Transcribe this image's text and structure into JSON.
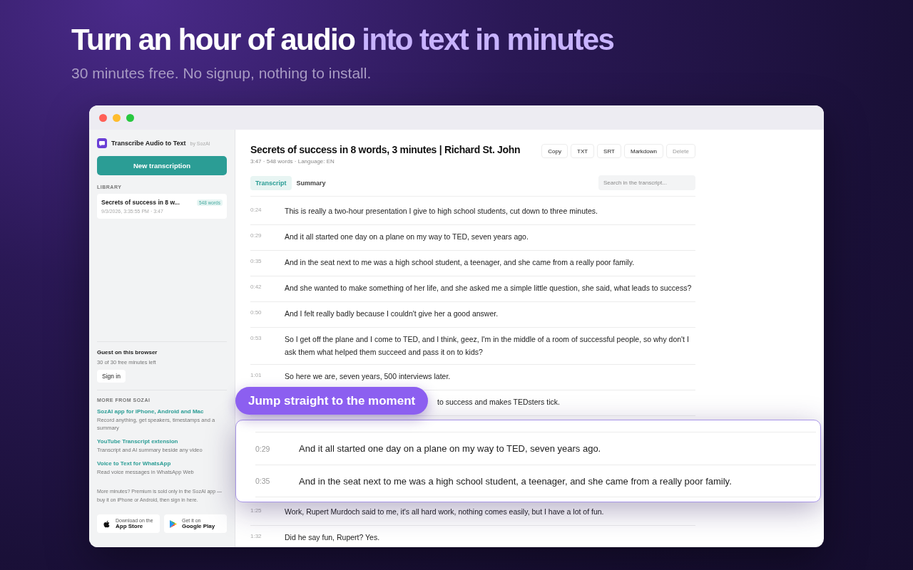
{
  "hero": {
    "title_plain": "Turn an hour of audio",
    "title_highlight": "into text in minutes",
    "subtitle": "30 minutes free. No signup, nothing to install."
  },
  "sidebar": {
    "app_title": "Transcribe Audio to Text",
    "app_by": "by SozAI",
    "new_button": "New transcription",
    "library_label": "LIBRARY",
    "library": [
      {
        "title": "Secrets of success in 8 w...",
        "badge": "548 words",
        "meta": "9/3/2026, 3:35:55 PM · 3:47",
        "selected": true
      }
    ],
    "guest_title": "Guest on this browser",
    "guest_minutes": "30 of 30 free minutes left",
    "sign_in": "Sign in",
    "more_label": "MORE FROM SOZAI",
    "links": [
      {
        "title": "SozAI app for iPhone, Android and Mac",
        "desc": "Record anything, get speakers, timestamps and a summary"
      },
      {
        "title": "YouTube Transcript extension",
        "desc": "Transcript and AI summary beside any video"
      },
      {
        "title": "Voice to Text for WhatsApp",
        "desc": "Read voice messages in WhatsApp Web"
      }
    ],
    "premium_note": "More minutes? Premium is sold only in the SozAI app — buy it on iPhone or Android, then sign in here.",
    "stores": [
      {
        "kind": "apple",
        "small": "Download on the",
        "big": "App Store"
      },
      {
        "kind": "google",
        "small": "Get it on",
        "big": "Google Play"
      }
    ]
  },
  "main": {
    "title": "Secrets of success in 8 words, 3 minutes | Richard St. John",
    "meta": "3:47 · 548 words · Language: EN",
    "actions": [
      {
        "label": "Copy",
        "disabled": false
      },
      {
        "label": "TXT",
        "disabled": false
      },
      {
        "label": "SRT",
        "disabled": false
      },
      {
        "label": "Markdown",
        "disabled": false
      },
      {
        "label": "Delete",
        "disabled": true
      }
    ],
    "tabs": [
      {
        "label": "Transcript",
        "selected": true
      },
      {
        "label": "Summary",
        "selected": false
      }
    ],
    "search": {
      "placeholder": "Search in the transcript..."
    },
    "rows": [
      {
        "time": "0:24",
        "text": "This is really a two-hour presentation I give to high school students, cut down to three minutes."
      },
      {
        "time": "0:29",
        "text": "And it all started one day on a plane on my way to TED, seven years ago."
      },
      {
        "time": "0:35",
        "text": "And in the seat next to me was a high school student, a teenager, and she came from a really poor family."
      },
      {
        "time": "0:42",
        "text": "And she wanted to make something of her life, and she asked me a simple little question, she said, what leads to success?"
      },
      {
        "time": "0:50",
        "text": "And I felt really badly because I couldn't give her a good answer."
      },
      {
        "time": "0:53",
        "text": "So I get off the plane and I come to TED, and I think, geez, I'm in the middle of a room of successful people, so why don't I ask them what helped them succeed and pass it on to kids?"
      },
      {
        "time": "1:01",
        "text": "So here we are, seven years, 500 interviews later."
      }
    ],
    "partial_row": {
      "text": "to success and makes TEDsters tick."
    },
    "rows_below": [
      {
        "time": "1:25",
        "text": "Work, Rupert Murdoch said to me, it's all hard work, nothing comes easily, but I have a lot of fun."
      },
      {
        "time": "1:32",
        "text": "Did he say fun, Rupert? Yes."
      }
    ]
  },
  "callout": {
    "label": "Jump straight to the moment",
    "rows": [
      {
        "time": "0:29",
        "text": "And it all started one day on a plane on my way to TED, seven years ago."
      },
      {
        "time": "0:35",
        "text": "And in the seat next to me was a high school student, a teenager, and she came from a really poor family."
      }
    ]
  }
}
